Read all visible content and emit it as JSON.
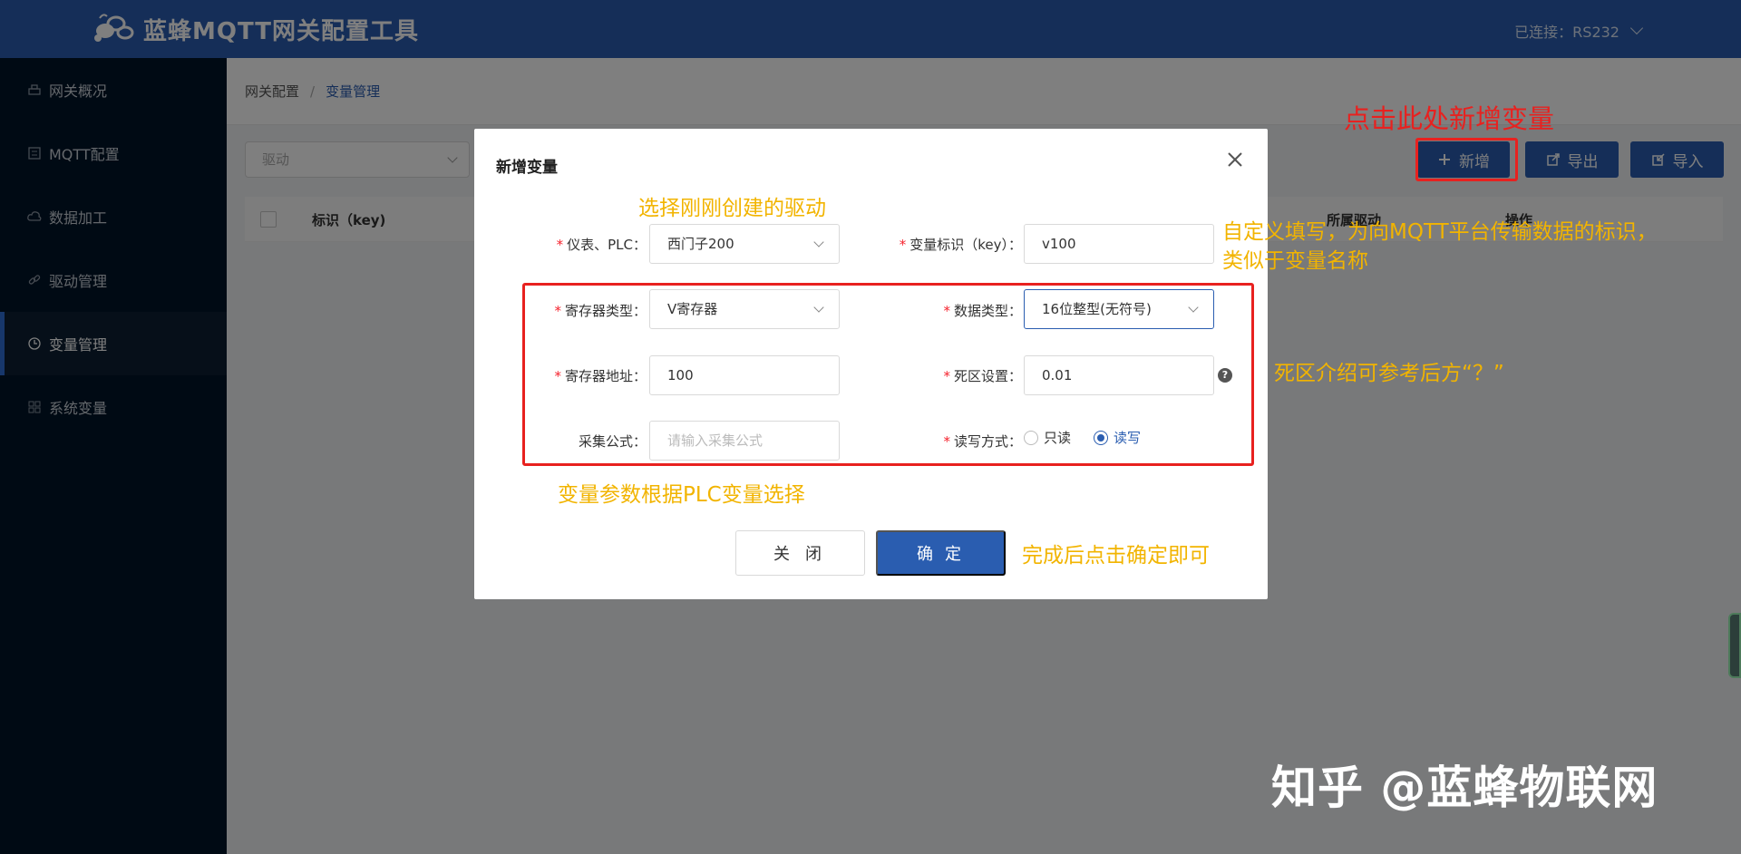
{
  "header": {
    "title": "蓝蜂MQTT网关配置工具",
    "connection": "已连接：RS232"
  },
  "sidebar": {
    "items": [
      {
        "label": "网关概况",
        "icon": "printer-icon"
      },
      {
        "label": "MQTT配置",
        "icon": "list-icon"
      },
      {
        "label": "数据加工",
        "icon": "cloud-icon"
      },
      {
        "label": "驱动管理",
        "icon": "link-icon"
      },
      {
        "label": "变量管理",
        "icon": "clock-icon",
        "active": true
      },
      {
        "label": "系统变量",
        "icon": "grid-icon"
      }
    ]
  },
  "breadcrumb": {
    "parent": "网关配置",
    "current": "变量管理"
  },
  "toolbar": {
    "driver_placeholder": "驱动",
    "add_label": "新增",
    "export_label": "导出",
    "import_label": "导入"
  },
  "table": {
    "headers": [
      "标识（key)",
      "所属驱动",
      "操作"
    ]
  },
  "modal": {
    "title": "新增变量",
    "fields": {
      "device_label": "仪表、PLC：",
      "device_value": "西门子200",
      "key_label": "变量标识（key）：",
      "key_value": "v100",
      "reg_type_label": "寄存器类型：",
      "reg_type_value": "V寄存器",
      "data_type_label": "数据类型：",
      "data_type_value": "16位整型(无符号)",
      "reg_addr_label": "寄存器地址：",
      "reg_addr_value": "100",
      "deadband_label": "死区设置：",
      "deadband_value": "0.01",
      "formula_label": "采集公式：",
      "formula_placeholder": "请输入采集公式",
      "rw_label": "读写方式：",
      "rw_options": [
        "只读",
        "读写"
      ],
      "rw_selected": "读写"
    },
    "close_label": "关 闭",
    "confirm_label": "确 定"
  },
  "annotations": {
    "add_hint": "点击此处新增变量",
    "driver_hint": "选择刚刚创建的驱动",
    "key_hint_line1": "自定义填写，为向MQTT平台传输数据的标识，",
    "key_hint_line2": "类似于变量名称",
    "deadband_hint": "死区介绍可参考后方“？”",
    "params_hint": "变量参数根据PLC变量选择",
    "confirm_hint": "完成后点击确定即可"
  },
  "watermark": "知乎 @蓝蜂物联网",
  "colors": {
    "primary": "#2a5db0",
    "sidebar": "#001529",
    "annotation_yellow": "#f2b400",
    "annotation_red": "#e8211f"
  }
}
